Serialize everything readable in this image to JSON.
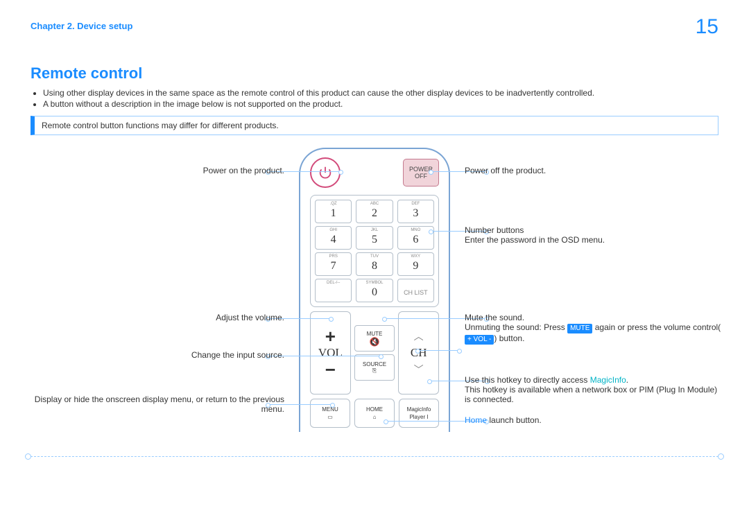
{
  "header": {
    "chapter": "Chapter 2. Device setup",
    "page_number": "15"
  },
  "title": "Remote control",
  "bullets": [
    "Using other display devices in the same space as the remote control of this product can cause the other display devices to be inadvertently controlled.",
    "A button without a description in the image below is not supported on the product."
  ],
  "callout": "Remote control button functions may differ for different products.",
  "remote": {
    "power_off_top": "POWER",
    "power_off_bottom": "OFF",
    "keypad": [
      {
        "sub": ".QZ",
        "n": "1"
      },
      {
        "sub": "ABC",
        "n": "2"
      },
      {
        "sub": "DEF",
        "n": "3"
      },
      {
        "sub": "GHI",
        "n": "4"
      },
      {
        "sub": "JKL",
        "n": "5"
      },
      {
        "sub": "MNO",
        "n": "6"
      },
      {
        "sub": "PRS",
        "n": "7"
      },
      {
        "sub": "TUV",
        "n": "8"
      },
      {
        "sub": "WXY",
        "n": "9"
      },
      {
        "sub": "DEL-/--",
        "n": ""
      },
      {
        "sub": "SYMBOL",
        "n": "0"
      },
      {
        "sub": "",
        "n": "CH LIST"
      }
    ],
    "vol": "VOL",
    "ch": "CH",
    "mute": "MUTE",
    "source": "SOURCE",
    "menu": "MENU",
    "home": "HOME",
    "magicinfo_top": "MagicInfo",
    "magicinfo_bot": "Player I"
  },
  "ann": {
    "power_on": "Power on the product.",
    "power_off": "Power off the product.",
    "numbers_l1": "Number buttons",
    "numbers_l2": "Enter the password in the OSD menu.",
    "vol": "Adjust the volume.",
    "source": "Change the input source.",
    "menu": "Display or hide the onscreen display menu, or return to the previous menu.",
    "mute_l1": "Mute the sound.",
    "mute_l2a": "Unmuting the sound: Press ",
    "mute_badge": "MUTE",
    "mute_l2b": " again or press the volume control(",
    "vol_badge": "+ VOL -",
    "mute_l2c": ") button.",
    "mi_l1a": "Use this hotkey to directly access ",
    "mi_link": "MagicInfo",
    "mi_l1b": ".",
    "mi_l2": "This hotkey is available when a network box or PIM (Plug In Module) is connected.",
    "home_a": "Home",
    "home_b": " launch button."
  }
}
